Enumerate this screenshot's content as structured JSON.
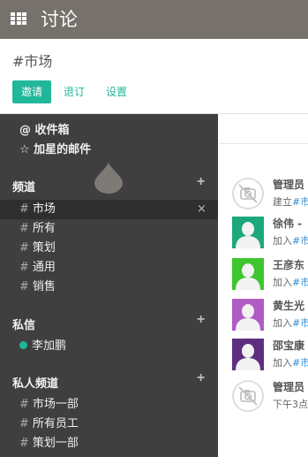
{
  "app": {
    "title": "讨论"
  },
  "channel": {
    "title": "#市场"
  },
  "actions": {
    "invite": "邀请",
    "unsubscribe": "退订",
    "settings": "设置"
  },
  "sidebar": {
    "inbox": "@ 收件箱",
    "starred": "☆ 加星的邮件",
    "channels_header": "频道",
    "channels": [
      "市场",
      "所有",
      "策划",
      "通用",
      "销售"
    ],
    "active_channel": "市场",
    "dm_header": "私信",
    "direct_messages": [
      "李加鹏"
    ],
    "private_header": "私人频道",
    "private_channels": [
      "市场一部",
      "所有员工",
      "策划一部"
    ],
    "hash": "#",
    "plus": "+",
    "close": "×"
  },
  "messages": [
    {
      "name": "管理员",
      "text_prefix": "建立",
      "link": "#市",
      "avatar": "camera-icon"
    },
    {
      "name": "徐伟 -",
      "text_prefix": "加入",
      "link": "#市",
      "avatar": "user",
      "color": "#1ba87c"
    },
    {
      "name": "王彦东",
      "text_prefix": "加入",
      "link": "#市",
      "avatar": "user",
      "color": "#3ec62f"
    },
    {
      "name": "黄生光",
      "text_prefix": "加入",
      "link": "#市",
      "avatar": "user",
      "color": "#b05cc4"
    },
    {
      "name": "邵宝康",
      "text_prefix": "加入",
      "link": "#市",
      "avatar": "user",
      "color": "#5e2f7f"
    },
    {
      "name": "管理员",
      "text_prefix": "下午3点",
      "link": "",
      "avatar": "camera-icon"
    }
  ]
}
